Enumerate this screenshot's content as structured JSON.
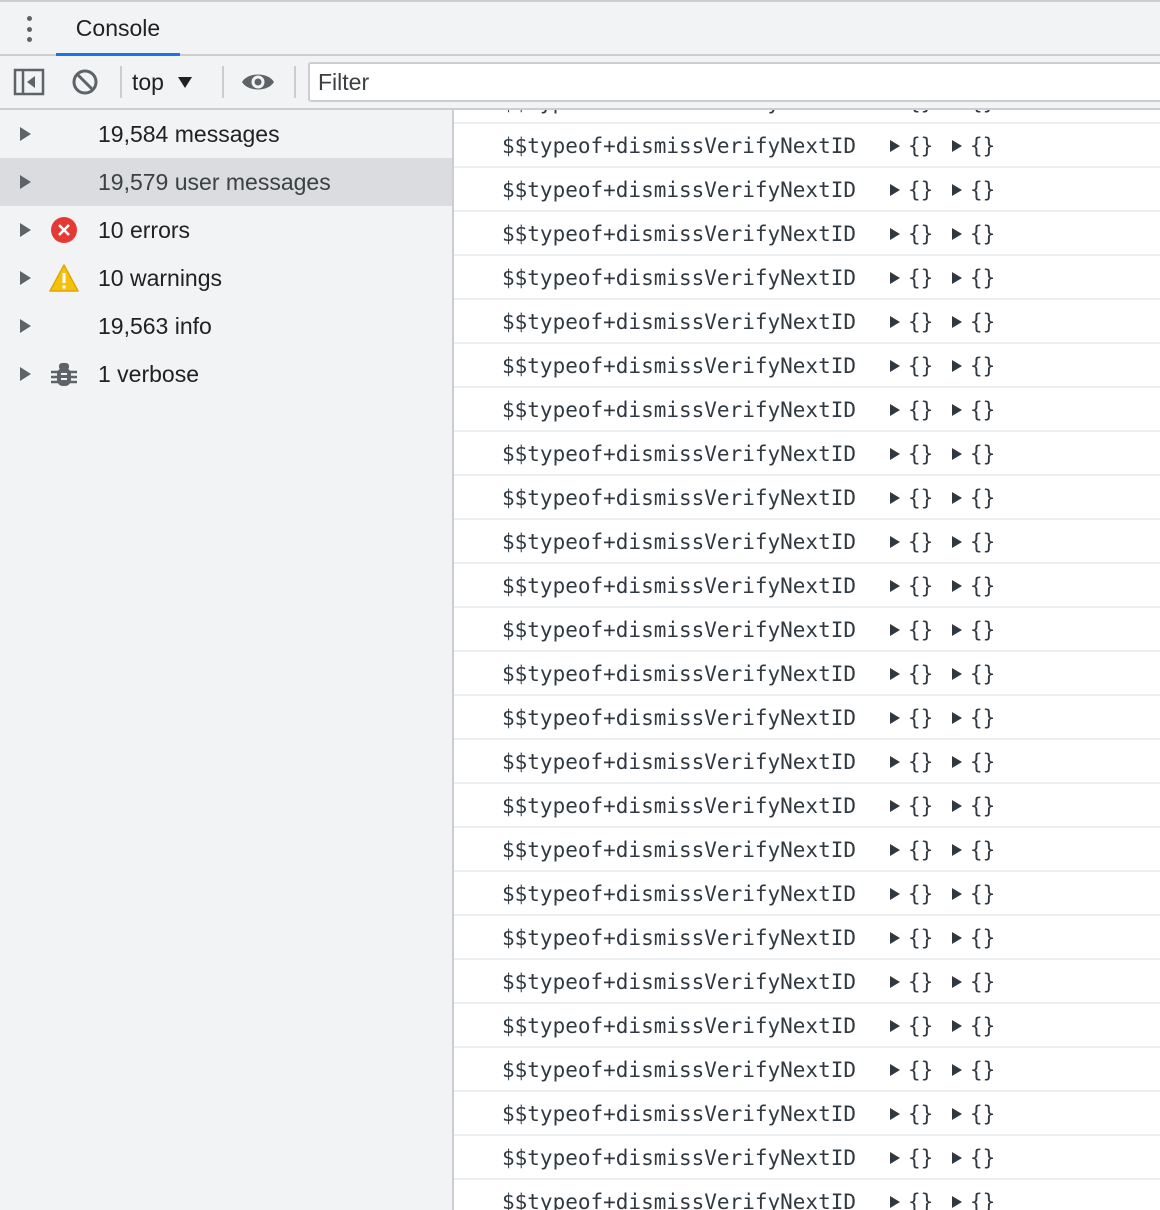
{
  "tabs": {
    "active_label": "Console"
  },
  "toolbar": {
    "context_label": "top",
    "filter_placeholder": "Filter",
    "icons": [
      "sidebar-toggle-icon",
      "clear-console-icon",
      "caret-down-icon",
      "eye-icon"
    ]
  },
  "sidebar": {
    "items": [
      {
        "label": "19,584 messages",
        "icon": "",
        "selected": false
      },
      {
        "label": "19,579 user messages",
        "icon": "",
        "selected": true
      },
      {
        "label": "10 errors",
        "icon": "error-icon",
        "selected": false
      },
      {
        "label": "10 warnings",
        "icon": "warning-icon",
        "selected": false
      },
      {
        "label": "19,563 info",
        "icon": "",
        "selected": false
      },
      {
        "label": "1 verbose",
        "icon": "bug-icon",
        "selected": false
      }
    ]
  },
  "log": {
    "row_text": "$$typeof+dismissVerifyNextID",
    "object_preview": "{}",
    "visible_rows": 26
  },
  "colors": {
    "panel_bg": "#f1f3f4",
    "accent": "#1a73e8",
    "error": "#e53935",
    "warning": "#f4c20d",
    "selected_bg": "#dadcdf"
  }
}
